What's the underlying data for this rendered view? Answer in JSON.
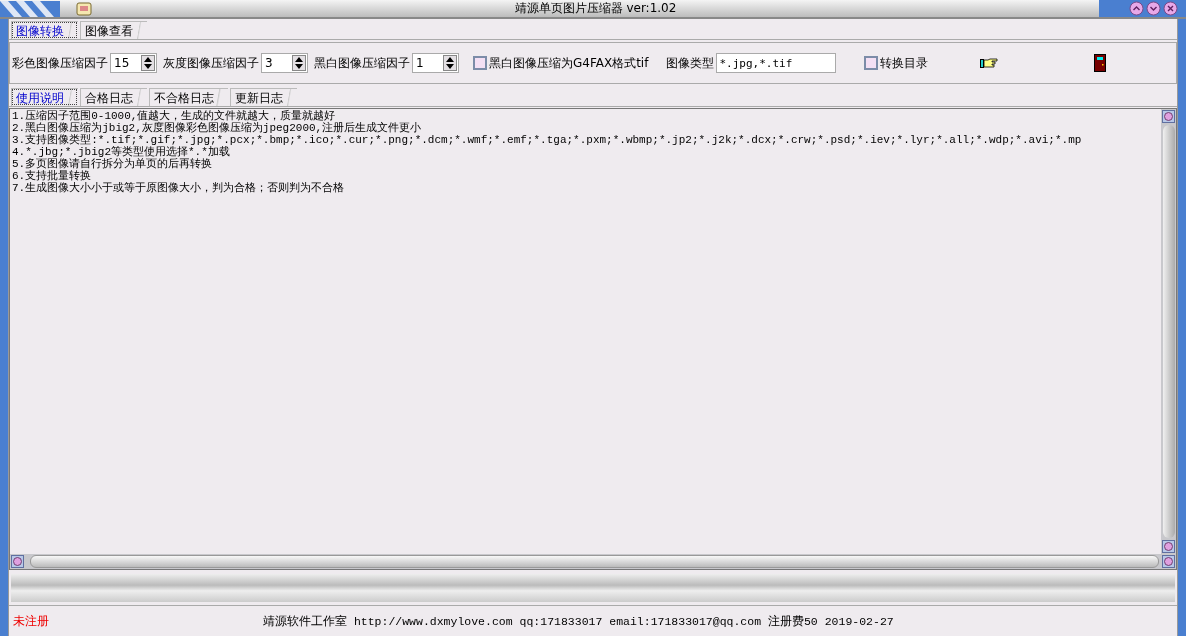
{
  "window": {
    "title": "靖源单页图片压缩器 ver:1.02"
  },
  "tabs": [
    {
      "label": "图像转换",
      "selected": true
    },
    {
      "label": "图像查看",
      "selected": false
    }
  ],
  "options": {
    "fields": [
      {
        "label": "彩色图像压缩因子",
        "value": "15"
      },
      {
        "label": "灰度图像压缩因子",
        "value": "3"
      },
      {
        "label": "黑白图像压缩因子",
        "value": "1"
      }
    ],
    "g4fax": {
      "label": "黑白图像压缩为G4FAX格式tif",
      "checked": false
    },
    "image_type": {
      "label": "图像类型",
      "value": "*.jpg,*.tif"
    },
    "convert_dir": {
      "label": "转换目录",
      "checked": false
    }
  },
  "log_tabs": [
    {
      "label": "使用说明",
      "selected": true
    },
    {
      "label": "合格日志",
      "selected": false
    },
    {
      "label": "不合格日志",
      "selected": false
    },
    {
      "label": "更新日志",
      "selected": false
    }
  ],
  "memo_lines": [
    "1.压缩因子范围0-1000,值越大，生成的文件就越大，质量就越好",
    "2.黑白图像压缩为jbig2,灰度图像彩色图像压缩为jpeg2000,注册后生成文件更小",
    "3.支持图像类型:*.tif;*.gif;*.jpg;*.pcx;*.bmp;*.ico;*.cur;*.png;*.dcm;*.wmf;*.emf;*.tga;*.pxm;*.wbmp;*.jp2;*.j2k;*.dcx;*.crw;*.psd;*.iev;*.lyr;*.all;*.wdp;*.avi;*.mp",
    "4.*.jbg;*.jbig2等类型使用选择*.*加载",
    "5.多页图像请自行拆分为单页的后再转换",
    "6.支持批量转换",
    "7.生成图像大小小于或等于原图像大小，判为合格；否则判为不合格"
  ],
  "status_bar": {
    "registration": "未注册",
    "info": "靖源软件工作室 http://www.dxmylove.com qq:171833017 email:171833017@qq.com 注册费50 2019-02-27"
  }
}
